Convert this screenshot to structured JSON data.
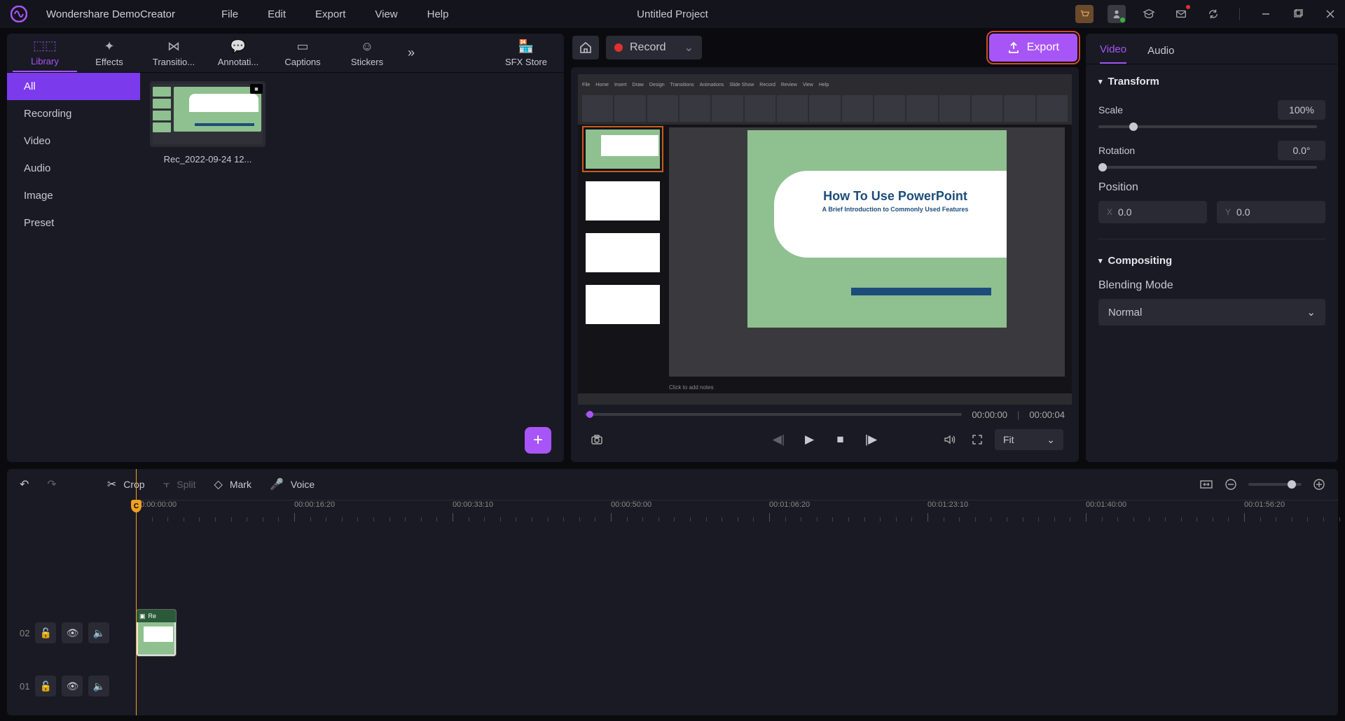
{
  "app_name": "Wondershare DemoCreator",
  "project_title": "Untitled Project",
  "menus": [
    "File",
    "Edit",
    "Export",
    "View",
    "Help"
  ],
  "top_tabs": {
    "library": "Library",
    "effects": "Effects",
    "transitions": "Transitio...",
    "annotations": "Annotati...",
    "captions": "Captions",
    "stickers": "Stickers",
    "sfx": "SFX Store"
  },
  "lib_categories": [
    "All",
    "Recording",
    "Video",
    "Audio",
    "Image",
    "Preset"
  ],
  "clip": {
    "name": "Rec_2022-09-24 12..."
  },
  "record_label": "Record",
  "export_label": "Export",
  "preview_slide": {
    "title": "How To Use PowerPoint",
    "subtitle": "A Brief Introduction to Commonly Used Features",
    "notes": "Click to add notes"
  },
  "timecode_current": "00:00:00",
  "timecode_total": "00:00:04",
  "fit_label": "Fit",
  "prop_tabs": {
    "video": "Video",
    "audio": "Audio"
  },
  "transform": {
    "header": "Transform",
    "scale_label": "Scale",
    "scale_value": "100%",
    "rotation_label": "Rotation",
    "rotation_value": "0.0°",
    "position_label": "Position",
    "pos_x": "0.0",
    "pos_y": "0.0"
  },
  "compositing": {
    "header": "Compositing",
    "blend_label": "Blending Mode",
    "blend_value": "Normal"
  },
  "tl_tools": {
    "crop": "Crop",
    "split": "Split",
    "mark": "Mark",
    "voice": "Voice"
  },
  "ruler_ticks": [
    "00:00:00:00",
    "00:00:16:20",
    "00:00:33:10",
    "00:00:50:00",
    "00:01:06:20",
    "00:01:23:10",
    "00:01:40:00",
    "00:01:56:20"
  ],
  "track_nums": {
    "t1": "01",
    "t2": "02"
  },
  "clip_short": "Re",
  "playhead_letter": "C"
}
